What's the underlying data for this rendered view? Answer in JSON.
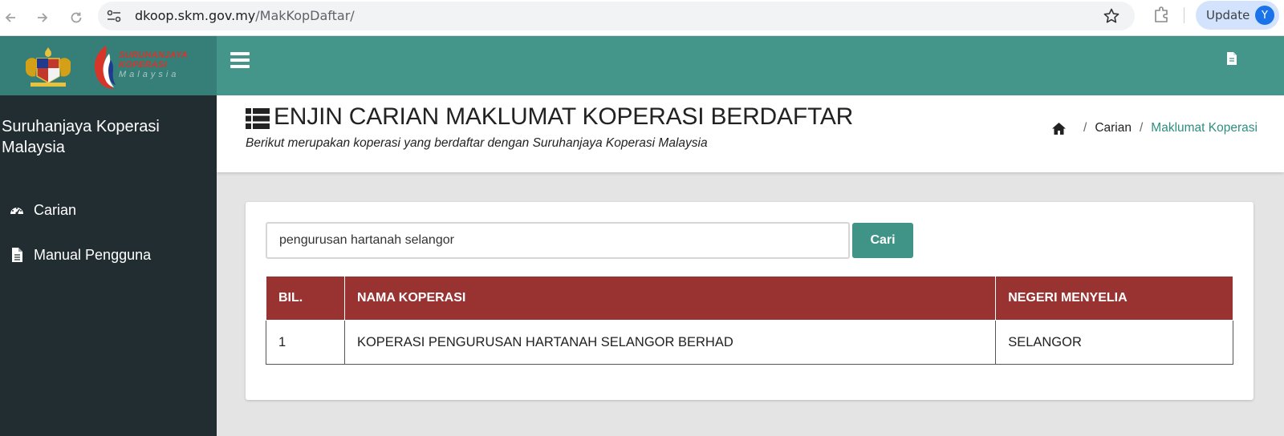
{
  "browser": {
    "url_host": "dkoop.skm.gov.my",
    "url_path": "/MakKopDaftar/",
    "update_label": "Update",
    "avatar_initial": "Y"
  },
  "brand": {
    "logo_line1": "SURUHANJAYA",
    "logo_line2": "KOPERASI",
    "logo_line3": "Malaysia"
  },
  "sidebar": {
    "org_name": "Suruhanjaya Koperasi Malaysia",
    "items": [
      {
        "label": "Carian",
        "icon": "dashboard-icon"
      },
      {
        "label": "Manual Pengguna",
        "icon": "document-icon"
      }
    ]
  },
  "header": {
    "title": "ENJIN CARIAN MAKLUMAT KOPERASI BERDAFTAR",
    "subtitle": "Berikut merupakan koperasi yang berdaftar dengan Suruhanjaya Koperasi Malaysia",
    "breadcrumb": [
      "Carian",
      "Maklumat Koperasi"
    ]
  },
  "search": {
    "value": "pengurusan hartanah selangor",
    "button_label": "Cari"
  },
  "table": {
    "headers": [
      "BIL.",
      "NAMA KOPERASI",
      "NEGERI MENYELIA"
    ],
    "rows": [
      [
        "1",
        "KOPERASI PENGURUSAN HARTANAH SELANGOR BERHAD",
        "SELANGOR"
      ]
    ]
  },
  "colors": {
    "topbar": "#44968b",
    "sidebar": "#222d32",
    "table_header": "#993331",
    "accent": "#3f9487"
  }
}
